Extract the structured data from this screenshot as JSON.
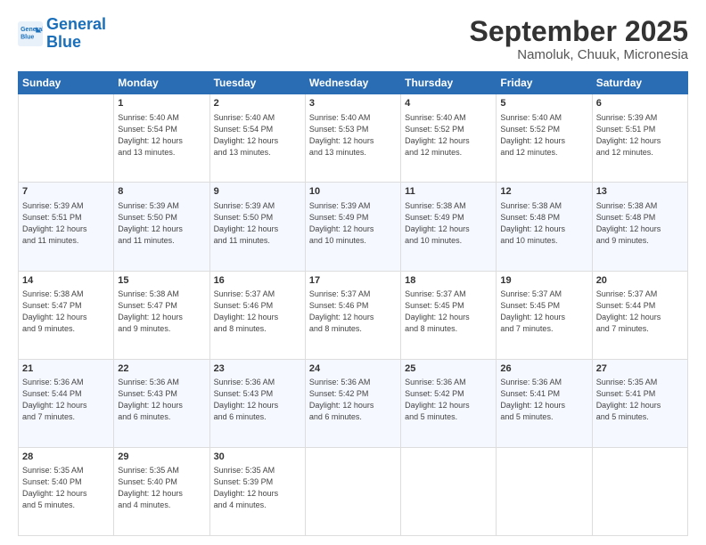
{
  "header": {
    "logo_line1": "General",
    "logo_line2": "Blue",
    "month": "September 2025",
    "location": "Namoluk, Chuuk, Micronesia"
  },
  "weekdays": [
    "Sunday",
    "Monday",
    "Tuesday",
    "Wednesday",
    "Thursday",
    "Friday",
    "Saturday"
  ],
  "weeks": [
    [
      {
        "day": "",
        "info": ""
      },
      {
        "day": "1",
        "info": "Sunrise: 5:40 AM\nSunset: 5:54 PM\nDaylight: 12 hours\nand 13 minutes."
      },
      {
        "day": "2",
        "info": "Sunrise: 5:40 AM\nSunset: 5:54 PM\nDaylight: 12 hours\nand 13 minutes."
      },
      {
        "day": "3",
        "info": "Sunrise: 5:40 AM\nSunset: 5:53 PM\nDaylight: 12 hours\nand 13 minutes."
      },
      {
        "day": "4",
        "info": "Sunrise: 5:40 AM\nSunset: 5:52 PM\nDaylight: 12 hours\nand 12 minutes."
      },
      {
        "day": "5",
        "info": "Sunrise: 5:40 AM\nSunset: 5:52 PM\nDaylight: 12 hours\nand 12 minutes."
      },
      {
        "day": "6",
        "info": "Sunrise: 5:39 AM\nSunset: 5:51 PM\nDaylight: 12 hours\nand 12 minutes."
      }
    ],
    [
      {
        "day": "7",
        "info": "Sunrise: 5:39 AM\nSunset: 5:51 PM\nDaylight: 12 hours\nand 11 minutes."
      },
      {
        "day": "8",
        "info": "Sunrise: 5:39 AM\nSunset: 5:50 PM\nDaylight: 12 hours\nand 11 minutes."
      },
      {
        "day": "9",
        "info": "Sunrise: 5:39 AM\nSunset: 5:50 PM\nDaylight: 12 hours\nand 11 minutes."
      },
      {
        "day": "10",
        "info": "Sunrise: 5:39 AM\nSunset: 5:49 PM\nDaylight: 12 hours\nand 10 minutes."
      },
      {
        "day": "11",
        "info": "Sunrise: 5:38 AM\nSunset: 5:49 PM\nDaylight: 12 hours\nand 10 minutes."
      },
      {
        "day": "12",
        "info": "Sunrise: 5:38 AM\nSunset: 5:48 PM\nDaylight: 12 hours\nand 10 minutes."
      },
      {
        "day": "13",
        "info": "Sunrise: 5:38 AM\nSunset: 5:48 PM\nDaylight: 12 hours\nand 9 minutes."
      }
    ],
    [
      {
        "day": "14",
        "info": "Sunrise: 5:38 AM\nSunset: 5:47 PM\nDaylight: 12 hours\nand 9 minutes."
      },
      {
        "day": "15",
        "info": "Sunrise: 5:38 AM\nSunset: 5:47 PM\nDaylight: 12 hours\nand 9 minutes."
      },
      {
        "day": "16",
        "info": "Sunrise: 5:37 AM\nSunset: 5:46 PM\nDaylight: 12 hours\nand 8 minutes."
      },
      {
        "day": "17",
        "info": "Sunrise: 5:37 AM\nSunset: 5:46 PM\nDaylight: 12 hours\nand 8 minutes."
      },
      {
        "day": "18",
        "info": "Sunrise: 5:37 AM\nSunset: 5:45 PM\nDaylight: 12 hours\nand 8 minutes."
      },
      {
        "day": "19",
        "info": "Sunrise: 5:37 AM\nSunset: 5:45 PM\nDaylight: 12 hours\nand 7 minutes."
      },
      {
        "day": "20",
        "info": "Sunrise: 5:37 AM\nSunset: 5:44 PM\nDaylight: 12 hours\nand 7 minutes."
      }
    ],
    [
      {
        "day": "21",
        "info": "Sunrise: 5:36 AM\nSunset: 5:44 PM\nDaylight: 12 hours\nand 7 minutes."
      },
      {
        "day": "22",
        "info": "Sunrise: 5:36 AM\nSunset: 5:43 PM\nDaylight: 12 hours\nand 6 minutes."
      },
      {
        "day": "23",
        "info": "Sunrise: 5:36 AM\nSunset: 5:43 PM\nDaylight: 12 hours\nand 6 minutes."
      },
      {
        "day": "24",
        "info": "Sunrise: 5:36 AM\nSunset: 5:42 PM\nDaylight: 12 hours\nand 6 minutes."
      },
      {
        "day": "25",
        "info": "Sunrise: 5:36 AM\nSunset: 5:42 PM\nDaylight: 12 hours\nand 5 minutes."
      },
      {
        "day": "26",
        "info": "Sunrise: 5:36 AM\nSunset: 5:41 PM\nDaylight: 12 hours\nand 5 minutes."
      },
      {
        "day": "27",
        "info": "Sunrise: 5:35 AM\nSunset: 5:41 PM\nDaylight: 12 hours\nand 5 minutes."
      }
    ],
    [
      {
        "day": "28",
        "info": "Sunrise: 5:35 AM\nSunset: 5:40 PM\nDaylight: 12 hours\nand 5 minutes."
      },
      {
        "day": "29",
        "info": "Sunrise: 5:35 AM\nSunset: 5:40 PM\nDaylight: 12 hours\nand 4 minutes."
      },
      {
        "day": "30",
        "info": "Sunrise: 5:35 AM\nSunset: 5:39 PM\nDaylight: 12 hours\nand 4 minutes."
      },
      {
        "day": "",
        "info": ""
      },
      {
        "day": "",
        "info": ""
      },
      {
        "day": "",
        "info": ""
      },
      {
        "day": "",
        "info": ""
      }
    ]
  ]
}
